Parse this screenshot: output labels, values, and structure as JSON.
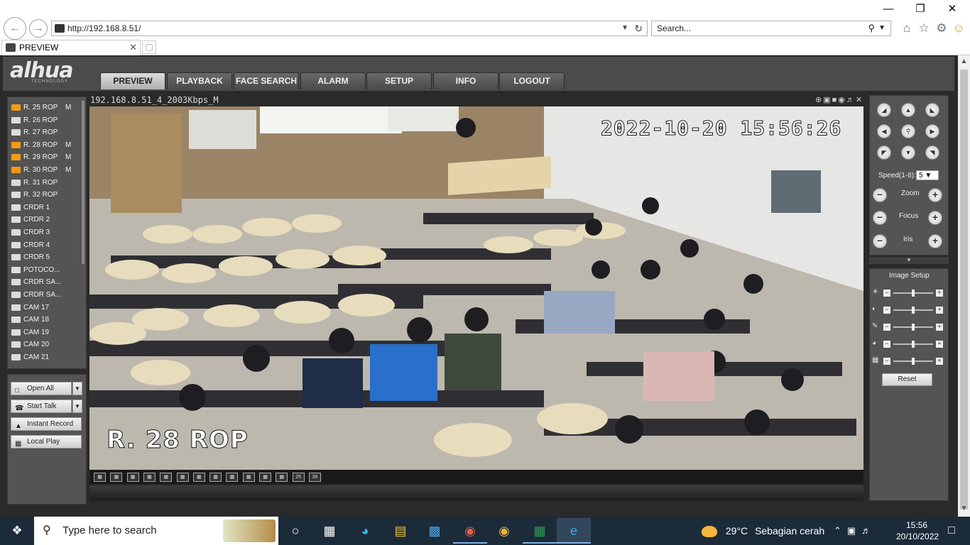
{
  "browser": {
    "url": "http://192.168.8.51/",
    "search_placeholder": "Search...",
    "tab_title": "PREVIEW"
  },
  "app": {
    "logo": "alhua",
    "logo_sub": "TECHNOLOGY",
    "menu_tabs": [
      "PREVIEW",
      "PLAYBACK",
      "FACE SEARCH",
      "ALARM",
      "SETUP",
      "INFO",
      "LOGOUT"
    ],
    "active_tab": "PREVIEW",
    "channels": [
      {
        "name": "R. 25 ROP",
        "flag": "M",
        "recording": true
      },
      {
        "name": "R. 26 ROP",
        "flag": "",
        "recording": false
      },
      {
        "name": "R. 27 ROP",
        "flag": "",
        "recording": false
      },
      {
        "name": "R. 28 ROP",
        "flag": "M",
        "recording": true
      },
      {
        "name": "R. 29 ROP",
        "flag": "M",
        "recording": true
      },
      {
        "name": "R. 30 ROP",
        "flag": "M",
        "recording": true
      },
      {
        "name": "R. 31 ROP",
        "flag": "",
        "recording": false
      },
      {
        "name": "R. 32 ROP",
        "flag": "",
        "recording": false
      },
      {
        "name": "CRDR 1",
        "flag": "",
        "recording": false
      },
      {
        "name": "CRDR 2",
        "flag": "",
        "recording": false
      },
      {
        "name": "CRDR 3",
        "flag": "",
        "recording": false
      },
      {
        "name": "CRDR 4",
        "flag": "",
        "recording": false
      },
      {
        "name": "CRDR 5",
        "flag": "",
        "recording": false
      },
      {
        "name": "POTOCO...",
        "flag": "",
        "recording": false
      },
      {
        "name": "CRDR SA...",
        "flag": "",
        "recording": false
      },
      {
        "name": "CRDR SA...",
        "flag": "",
        "recording": false
      },
      {
        "name": "CAM 17",
        "flag": "",
        "recording": false
      },
      {
        "name": "CAM 18",
        "flag": "",
        "recording": false
      },
      {
        "name": "CAM 19",
        "flag": "",
        "recording": false
      },
      {
        "name": "CAM 20",
        "flag": "",
        "recording": false
      },
      {
        "name": "CAM 21",
        "flag": "",
        "recording": false
      }
    ],
    "buttons": {
      "open_all": "Open All",
      "start_talk": "Start Talk",
      "instant_record": "Instant Record",
      "local_play": "Local Play"
    },
    "video": {
      "stream_label": "192.168.8.51_4_2003Kbps_M",
      "timestamp": "2022-10-20 15:56:26",
      "camera_name": "R. 28 ROP"
    },
    "layout_buttons": [
      "",
      "",
      "",
      "",
      "",
      "",
      "",
      "",
      "",
      "",
      "",
      "",
      "25",
      "36"
    ],
    "ptz": {
      "speed_label": "Speed(1-8):",
      "speed_value": "5",
      "zoom_label": "Zoom",
      "focus_label": "Focus",
      "iris_label": "Iris"
    },
    "image_setup": {
      "title": "Image Setup",
      "sliders": [
        {
          "icon": "brightness-icon",
          "value": 0.5
        },
        {
          "icon": "contrast-icon",
          "value": 0.5
        },
        {
          "icon": "saturation-icon",
          "value": 0.5
        },
        {
          "icon": "hue-icon",
          "value": 0.5
        },
        {
          "icon": "sharpness-icon",
          "value": 0.5
        }
      ],
      "reset_label": "Reset"
    }
  },
  "taskbar": {
    "search_placeholder": "Type here to search",
    "weather_temp": "29°C",
    "weather_desc": "Sebagian cerah",
    "time": "15:56",
    "date": "20/10/2022"
  },
  "colors": {
    "app_bg": "#2a2a2a",
    "panel_bg": "#545454",
    "recording_icon": "#f39b12",
    "taskbar_bg": "#1c2b3a"
  }
}
